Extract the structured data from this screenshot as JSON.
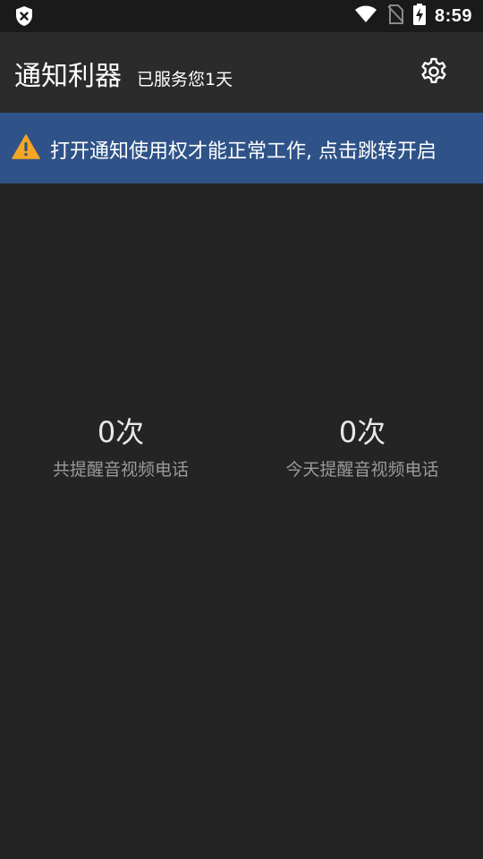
{
  "status_bar": {
    "time": "8:59",
    "icons": [
      "shield-x-icon",
      "wifi-icon",
      "no-sim-icon",
      "battery-charging-icon"
    ]
  },
  "app_bar": {
    "title": "通知利器",
    "subtitle": "已服务您1天",
    "settings_icon": "gear-icon"
  },
  "notice": {
    "icon": "warning-icon",
    "text": "打开通知使用权才能正常工作, 点击跳转开启",
    "background": "#2f5388",
    "icon_color": "#f5a623"
  },
  "stats": [
    {
      "value": "0次",
      "label": "共提醒音视频电话"
    },
    {
      "value": "0次",
      "label": "今天提醒音视频电话"
    }
  ]
}
